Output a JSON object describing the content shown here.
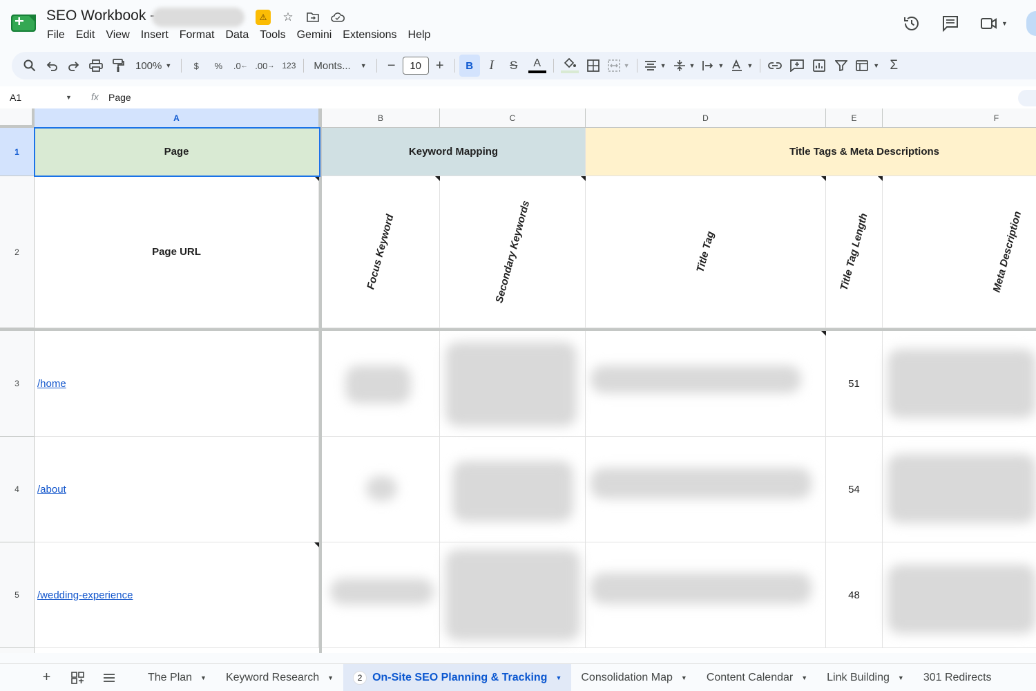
{
  "header": {
    "title": "SEO Workbook -",
    "menu": [
      "File",
      "Edit",
      "View",
      "Insert",
      "Format",
      "Data",
      "Tools",
      "Gemini",
      "Extensions",
      "Help"
    ]
  },
  "toolbar": {
    "zoom": "100%",
    "currency": "$",
    "percent": "%",
    "decrease_decimal": ".0",
    "increase_decimal": ".00",
    "number_format": "123",
    "font": "Monts...",
    "font_size": "10",
    "minus": "−",
    "plus": "+",
    "bold": "B",
    "italic": "I",
    "text_color": "A",
    "sigma": "Σ"
  },
  "formula_bar": {
    "cell_ref": "A1",
    "fx": "fx",
    "content": "Page"
  },
  "grid": {
    "columns": [
      "A",
      "B",
      "C",
      "D",
      "E",
      "F"
    ],
    "rows": [
      "1",
      "2",
      "3",
      "4",
      "5"
    ],
    "row1": {
      "a": "Page",
      "keyword_mapping": "Keyword Mapping",
      "title_meta": "Title Tags & Meta Descriptions"
    },
    "row2": {
      "a": "Page URL",
      "b": "Focus Keyword",
      "c": "Secondary Keywords",
      "d": "Title Tag",
      "e": "Title Tag Length",
      "f": "Meta Description"
    },
    "data_rows": [
      {
        "url": "/home",
        "title_length": "51"
      },
      {
        "url": "/about",
        "title_length": "54"
      },
      {
        "url": "/wedding-experience",
        "title_length": "48"
      }
    ]
  },
  "tabs": {
    "add": "+",
    "items": [
      {
        "label": "The Plan"
      },
      {
        "label": "Keyword Research"
      },
      {
        "label": "On-Site SEO Planning & Tracking",
        "badge": "2"
      },
      {
        "label": "Consolidation Map"
      },
      {
        "label": "Content Calendar"
      },
      {
        "label": "Link Building"
      },
      {
        "label": "301 Redirects"
      }
    ]
  },
  "colors": {
    "page_fill": "#d9ead3",
    "keyword_fill": "#d0e0e3",
    "title_fill": "#fff2cc",
    "selection": "#1a73e8",
    "link": "#1155cc"
  }
}
